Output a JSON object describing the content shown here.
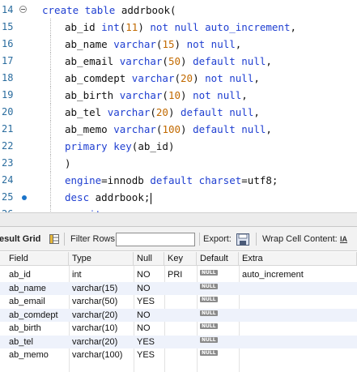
{
  "editor": {
    "lines": [
      {
        "num": "14",
        "dot": false,
        "fold": true,
        "tokens": [
          [
            "kw",
            "create table "
          ],
          [
            "id",
            "addrbook("
          ]
        ]
      },
      {
        "num": "15",
        "dot": false,
        "fold": false,
        "tokens": [
          [
            "id",
            "ab_id "
          ],
          [
            "ty",
            "int"
          ],
          [
            "id",
            "("
          ],
          [
            "num",
            "11"
          ],
          [
            "id",
            ") "
          ],
          [
            "kw",
            "not null auto_increment"
          ],
          [
            "id",
            ","
          ]
        ]
      },
      {
        "num": "16",
        "dot": false,
        "fold": false,
        "tokens": [
          [
            "id",
            "ab_name "
          ],
          [
            "ty",
            "varchar"
          ],
          [
            "id",
            "("
          ],
          [
            "num",
            "15"
          ],
          [
            "id",
            ") "
          ],
          [
            "kw",
            "not null"
          ],
          [
            "id",
            ","
          ]
        ]
      },
      {
        "num": "17",
        "dot": false,
        "fold": false,
        "tokens": [
          [
            "id",
            "ab_email "
          ],
          [
            "ty",
            "varchar"
          ],
          [
            "id",
            "("
          ],
          [
            "num",
            "50"
          ],
          [
            "id",
            ") "
          ],
          [
            "kw",
            "default null"
          ],
          [
            "id",
            ","
          ]
        ]
      },
      {
        "num": "18",
        "dot": false,
        "fold": false,
        "tokens": [
          [
            "id",
            "ab_comdept "
          ],
          [
            "ty",
            "varchar"
          ],
          [
            "id",
            "("
          ],
          [
            "num",
            "20"
          ],
          [
            "id",
            ") "
          ],
          [
            "kw",
            "not null"
          ],
          [
            "id",
            ","
          ]
        ]
      },
      {
        "num": "19",
        "dot": false,
        "fold": false,
        "tokens": [
          [
            "id",
            "ab_birth "
          ],
          [
            "ty",
            "varchar"
          ],
          [
            "id",
            "("
          ],
          [
            "num",
            "10"
          ],
          [
            "id",
            ") "
          ],
          [
            "kw",
            "not null"
          ],
          [
            "id",
            ","
          ]
        ]
      },
      {
        "num": "20",
        "dot": false,
        "fold": false,
        "tokens": [
          [
            "id",
            "ab_tel "
          ],
          [
            "ty",
            "varchar"
          ],
          [
            "id",
            "("
          ],
          [
            "num",
            "20"
          ],
          [
            "id",
            ") "
          ],
          [
            "kw",
            "default null"
          ],
          [
            "id",
            ","
          ]
        ]
      },
      {
        "num": "21",
        "dot": false,
        "fold": false,
        "tokens": [
          [
            "id",
            "ab_memo "
          ],
          [
            "ty",
            "varchar"
          ],
          [
            "id",
            "("
          ],
          [
            "num",
            "100"
          ],
          [
            "id",
            ") "
          ],
          [
            "kw",
            "default null"
          ],
          [
            "id",
            ","
          ]
        ]
      },
      {
        "num": "22",
        "dot": false,
        "fold": false,
        "tokens": [
          [
            "kw",
            "primary key"
          ],
          [
            "id",
            "(ab_id)"
          ]
        ]
      },
      {
        "num": "23",
        "dot": false,
        "fold": false,
        "tokens": [
          [
            "id",
            ")"
          ]
        ]
      },
      {
        "num": "24",
        "dot": false,
        "fold": false,
        "tokens": [
          [
            "kw",
            "engine"
          ],
          [
            "id",
            "=innodb "
          ],
          [
            "kw",
            "default charset"
          ],
          [
            "id",
            "=utf8;"
          ]
        ]
      },
      {
        "num": "25",
        "dot": true,
        "fold": false,
        "cursor": true,
        "tokens": [
          [
            "kw",
            "desc "
          ],
          [
            "id",
            "addrbook;"
          ]
        ]
      },
      {
        "num": "26",
        "dot": true,
        "fold": false,
        "tokens": [
          [
            "kw",
            "commit"
          ],
          [
            "id",
            ";"
          ]
        ]
      }
    ]
  },
  "toolbar": {
    "result_grid_label": "esult Grid",
    "filter_rows_label": "Filter Rows:",
    "filter_value": "",
    "export_label": "Export:",
    "wrap_label": "Wrap Cell Content:",
    "wrap_icon_glyph": "IA"
  },
  "grid": {
    "columns": [
      "Field",
      "Type",
      "Null",
      "Key",
      "Default",
      "Extra"
    ],
    "null_text": "NULL",
    "rows": [
      {
        "field": "ab_id",
        "type": "int",
        "null": "NO",
        "key": "PRI",
        "default": "NULL",
        "extra": "auto_increment"
      },
      {
        "field": "ab_name",
        "type": "varchar(15)",
        "null": "NO",
        "key": "",
        "default": "NULL",
        "extra": ""
      },
      {
        "field": "ab_email",
        "type": "varchar(50)",
        "null": "YES",
        "key": "",
        "default": "NULL",
        "extra": ""
      },
      {
        "field": "ab_comdept",
        "type": "varchar(20)",
        "null": "NO",
        "key": "",
        "default": "NULL",
        "extra": ""
      },
      {
        "field": "ab_birth",
        "type": "varchar(10)",
        "null": "NO",
        "key": "",
        "default": "NULL",
        "extra": ""
      },
      {
        "field": "ab_tel",
        "type": "varchar(20)",
        "null": "YES",
        "key": "",
        "default": "NULL",
        "extra": ""
      },
      {
        "field": "ab_memo",
        "type": "varchar(100)",
        "null": "YES",
        "key": "",
        "default": "NULL",
        "extra": ""
      }
    ]
  }
}
